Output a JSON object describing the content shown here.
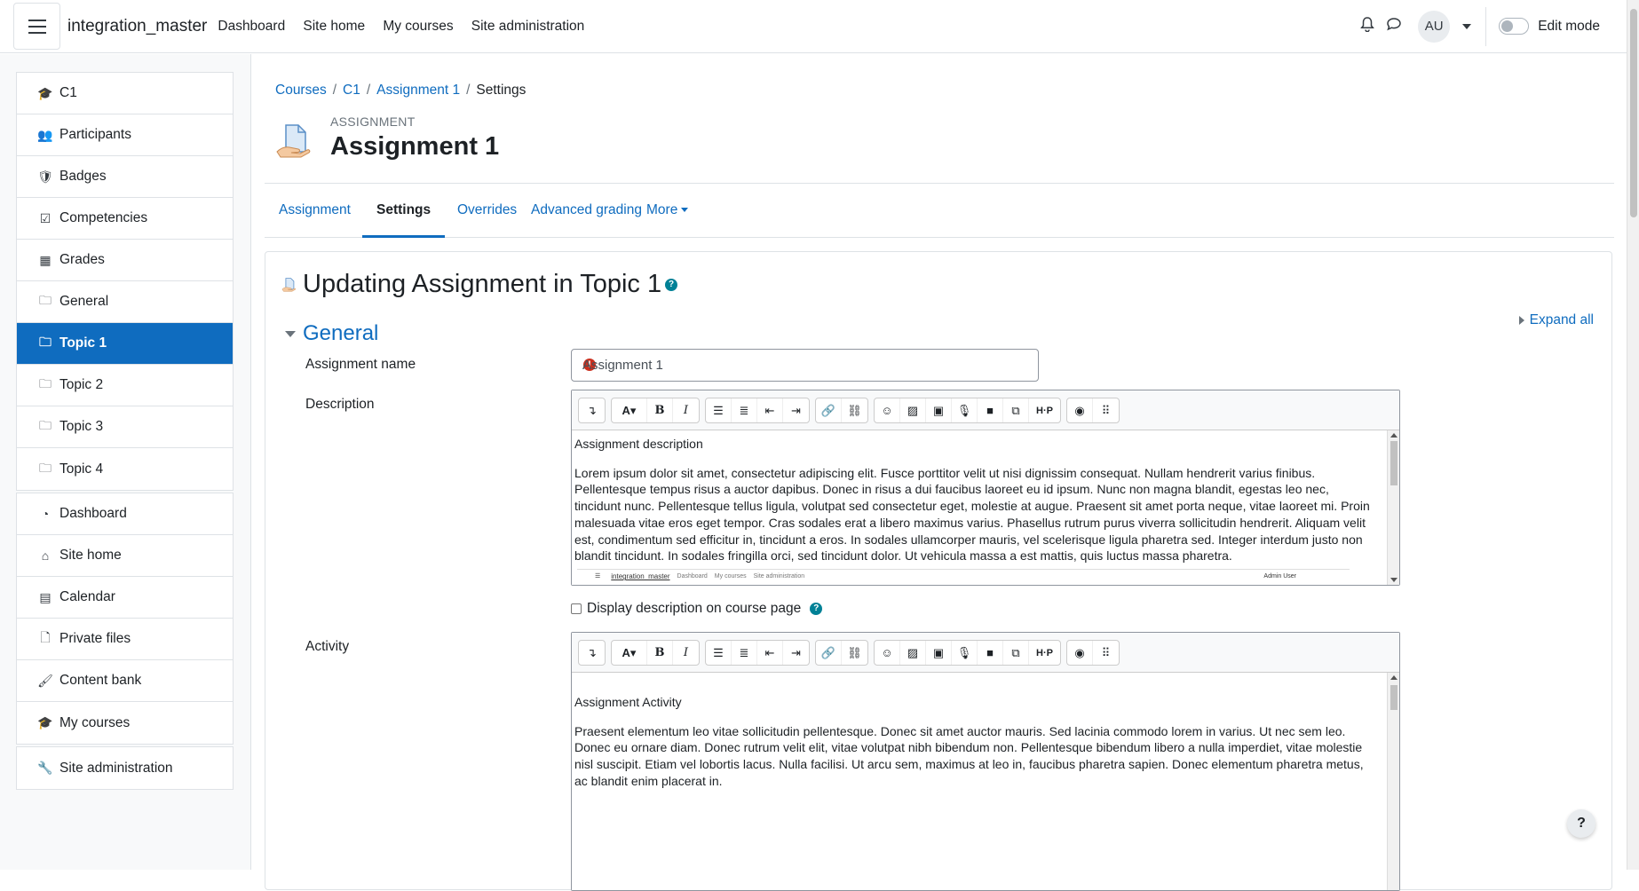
{
  "navbar": {
    "brand": "integration_master",
    "links": [
      "Dashboard",
      "Site home",
      "My courses",
      "Site administration"
    ],
    "avatar_initials": "AU",
    "edit_mode_label": "Edit mode",
    "edit_mode_on": false
  },
  "drawer": {
    "course_items": [
      {
        "label": "C1",
        "icon": "graduation-cap-icon"
      },
      {
        "label": "Participants",
        "icon": "users-icon"
      },
      {
        "label": "Badges",
        "icon": "shield-icon"
      },
      {
        "label": "Competencies",
        "icon": "checkbox-icon"
      },
      {
        "label": "Grades",
        "icon": "table-icon"
      },
      {
        "label": "General",
        "icon": "folder-icon"
      },
      {
        "label": "Topic 1",
        "icon": "folder-icon",
        "active": true
      },
      {
        "label": "Topic 2",
        "icon": "folder-icon"
      },
      {
        "label": "Topic 3",
        "icon": "folder-icon"
      },
      {
        "label": "Topic 4",
        "icon": "folder-icon"
      }
    ],
    "site_items": [
      {
        "label": "Dashboard",
        "icon": "dashboard-icon"
      },
      {
        "label": "Site home",
        "icon": "home-icon"
      },
      {
        "label": "Calendar",
        "icon": "calendar-icon"
      },
      {
        "label": "Private files",
        "icon": "file-icon"
      },
      {
        "label": "Content bank",
        "icon": "brush-icon"
      },
      {
        "label": "My courses",
        "icon": "graduation-cap-icon"
      }
    ],
    "admin_items": [
      {
        "label": "Site administration",
        "icon": "wrench-icon"
      }
    ]
  },
  "breadcrumb": [
    "Courses",
    "C1",
    "Assignment 1",
    "Settings"
  ],
  "header": {
    "module_type": "ASSIGNMENT",
    "title": "Assignment 1"
  },
  "tabs": [
    {
      "label": "Assignment"
    },
    {
      "label": "Settings",
      "active": true
    },
    {
      "label": "Overrides"
    },
    {
      "label": "Advanced grading"
    },
    {
      "label": "More"
    }
  ],
  "form": {
    "title": "Updating Assignment in Topic 1",
    "expand_all": "Expand all",
    "section": "General",
    "assignment_name_label": "Assignment name",
    "assignment_name_value": "Assignment 1",
    "description_label": "Description",
    "description_heading": "Assignment description",
    "description_text": "Lorem ipsum dolor sit amet, consectetur adipiscing elit. Fusce porttitor velit ut nisi dignissim consequat. Nullam hendrerit varius finibus. Pellentesque tempus risus a auctor dapibus. Donec in risus a dui faucibus laoreet eu id ipsum. Nunc non magna blandit, egestas leo nec, tincidunt nunc. Pellentesque tellus ligula, volutpat sed consectetur eget, molestie at augue. Praesent sit amet porta neque, vitae laoreet mi. Proin malesuada vitae eros eget tempor. Cras sodales erat a libero maximus varius. Phasellus rutrum purus viverra sollicitudin hendrerit. Aliquam velit est, condimentum sed efficitur in, tincidunt a eros. In sodales ullamcorper mauris, vel scelerisque ligula pharetra sed. Integer interdum justo non blandit tincidunt. In sodales fringilla orci, sed tincidunt dolor. Ut vehicula massa a est mattis, quis luctus massa pharetra.",
    "embedded_screenshot": {
      "brand": "integration_master",
      "links": [
        "Dashboard",
        "My courses",
        "Site administration"
      ],
      "user": "Admin User"
    },
    "display_description_label": "Display description on course page",
    "activity_label": "Activity",
    "activity_heading": "Assignment Activity",
    "activity_text": "Praesent elementum leo vitae sollicitudin pellentesque. Donec sit amet auctor mauris. Sed lacinia commodo lorem in varius. Ut nec sem leo. Donec eu ornare diam. Donec rutrum velit elit, vitae volutpat nibh bibendum non. Pellentesque bibendum libero a nulla imperdiet, vitae molestie nisl suscipit. Etiam vel lobortis lacus. Nulla facilisi. Ut arcu sem, maximus at leo in, faucibus pharetra sapien. Donec elementum pharetra metus, ac blandit enim placerat in."
  },
  "toolbar_buttons": [
    "show-more-icon",
    "font-style-icon",
    "bold-icon",
    "italic-icon",
    "bullet-list-icon",
    "numbered-list-icon",
    "outdent-icon",
    "indent-icon",
    "link-icon",
    "unlink-icon",
    "emoji-icon",
    "image-icon",
    "media-file-icon",
    "record-audio-icon",
    "record-video-icon",
    "manage-files-icon",
    "h5p-icon",
    "accessibility-checker-icon",
    "screenreader-helper-icon"
  ],
  "floating_help": "?",
  "colors": {
    "primary": "#0f6cbf",
    "required": "#ca3120",
    "help": "#008196"
  }
}
